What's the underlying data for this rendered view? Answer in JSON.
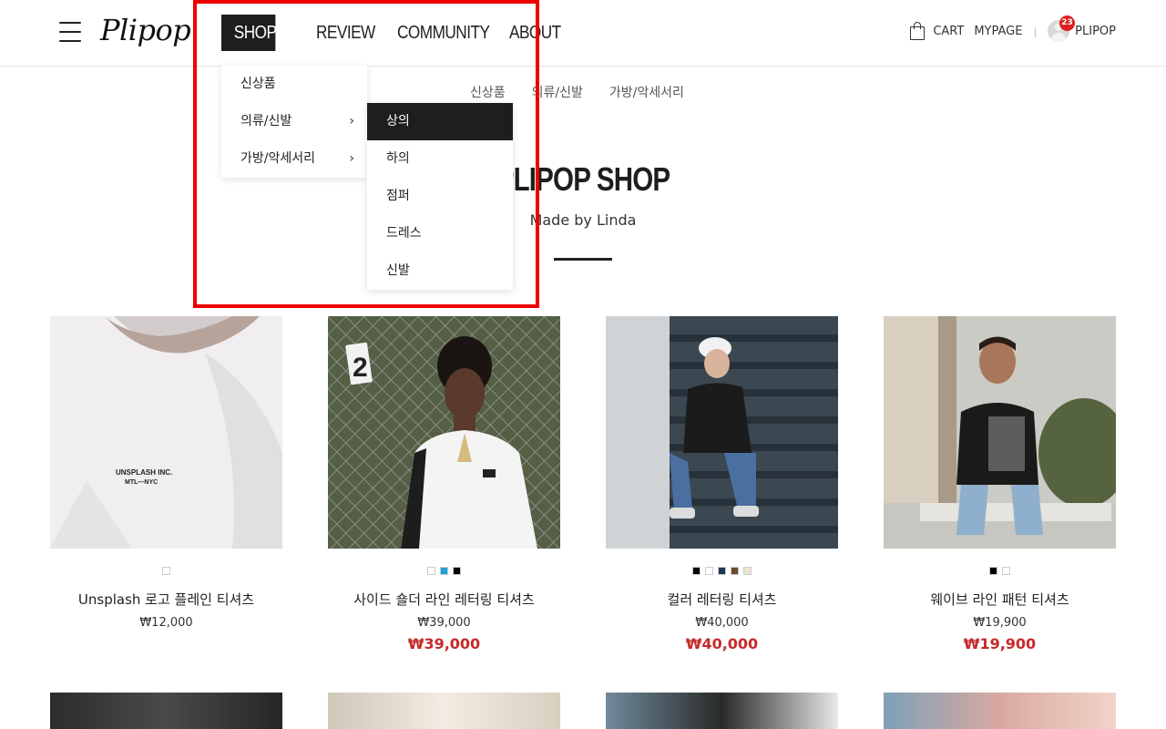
{
  "brand": {
    "logo_text": "Plipop"
  },
  "nav": {
    "items": [
      {
        "label": "SHOP"
      },
      {
        "label": "REVIEW"
      },
      {
        "label": "COMMUNITY"
      },
      {
        "label": "ABOUT"
      }
    ]
  },
  "util": {
    "cart_label": "CART",
    "mypage_label": "MYPAGE",
    "separator": "|",
    "badge_count": "23",
    "username": "PLIPOP"
  },
  "subnav": {
    "items": [
      "신상품",
      "의류/신발",
      "가방/악세서리"
    ]
  },
  "dropdown": {
    "items": [
      {
        "label": "신상품",
        "has_sub": false
      },
      {
        "label": "의류/신발",
        "has_sub": true
      },
      {
        "label": "가방/악세서리",
        "has_sub": true
      }
    ],
    "chevron": "›",
    "submenu": [
      "상의",
      "하의",
      "점퍼",
      "드레스",
      "신발"
    ]
  },
  "hero": {
    "title": "PLIPOP SHOP",
    "subtitle": "Made by Linda"
  },
  "colors": {
    "accent": "#1e1e1e",
    "sale": "#c62a2a",
    "badge": "#e0201e",
    "highlight": "#ee0000"
  },
  "products": [
    {
      "name": "Unsplash 로고 플레인 티셔츠",
      "price": "₩12,000",
      "sale": "",
      "swatches": [
        "#ffffff"
      ],
      "print": [
        "UNSPLASH INC.",
        "MTL—NYC"
      ]
    },
    {
      "name": "사이드 숄더 라인 레터링 티셔츠",
      "price": "₩39,000",
      "sale": "₩39,000",
      "swatches": [
        "#ffffff",
        "#1fa0d8",
        "#000000"
      ],
      "print": [
        "2"
      ]
    },
    {
      "name": "컬러 레터링 티셔츠",
      "price": "₩40,000",
      "sale": "₩40,000",
      "swatches": [
        "#000000",
        "#ffffff",
        "#1d3557",
        "#6b4a2b",
        "#ece3d0"
      ]
    },
    {
      "name": "웨이브 라인 패턴 티셔츠",
      "price": "₩19,900",
      "sale": "₩19,900",
      "swatches": [
        "#000000",
        "#ffffff"
      ]
    }
  ]
}
